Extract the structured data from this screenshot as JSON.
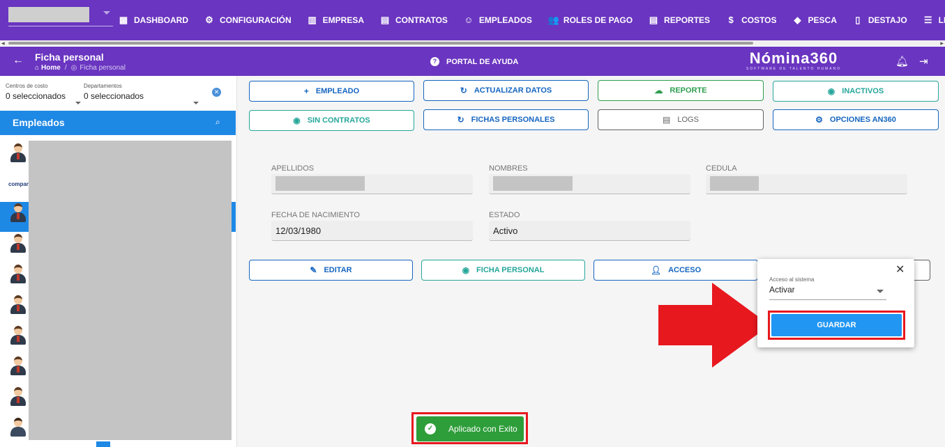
{
  "nav": {
    "items": [
      {
        "label": "DASHBOARD",
        "icon": "dashboard-icon",
        "glyph": "▦"
      },
      {
        "label": "CONFIGURACIÓN",
        "icon": "gear-icon",
        "glyph": "⚙"
      },
      {
        "label": "EMPRESA",
        "icon": "building-icon",
        "glyph": "▥"
      },
      {
        "label": "CONTRATOS",
        "icon": "clipboard-icon",
        "glyph": "▤"
      },
      {
        "label": "EMPLEADOS",
        "icon": "users-circle-icon",
        "glyph": "☺"
      },
      {
        "label": "ROLES DE PAGO",
        "icon": "group-icon",
        "glyph": "👥"
      },
      {
        "label": "REPORTES",
        "icon": "report-icon",
        "glyph": "▤"
      },
      {
        "label": "COSTOS",
        "icon": "invoice-icon",
        "glyph": "$"
      },
      {
        "label": "PESCA",
        "icon": "fish-icon",
        "glyph": "◆"
      },
      {
        "label": "DESTAJO",
        "icon": "document-icon",
        "glyph": "▯"
      },
      {
        "label": "LIQUIDACION",
        "icon": "list-icon",
        "glyph": "☰"
      }
    ]
  },
  "header": {
    "title": "Ficha personal",
    "breadcrumb_home": "Home",
    "breadcrumb_current": "Ficha personal",
    "help": "PORTAL DE AYUDA",
    "logo": "Nómina360",
    "logo_tagline": "SOFTWARE DE TALENTO HUMANO"
  },
  "filters": {
    "cost_centers_label": "Centros de costo",
    "cost_centers_value": "0 seleccionados",
    "departments_label": "Departamentos",
    "departments_value": "0 seleccionados"
  },
  "employees": {
    "title": "Empleados",
    "logo_text": "company"
  },
  "actions": {
    "empleado": "EMPLEADO",
    "actualizar": "ACTUALIZAR DATOS",
    "reporte": "REPORTE",
    "inactivos": "INACTIVOS",
    "sin_contratos": "SIN CONTRATOS",
    "fichas": "FICHAS PERSONALES",
    "logs": "LOGS",
    "opciones": "OPCIONES AN360"
  },
  "form": {
    "apellidos_label": "APELLIDOS",
    "nombres_label": "NOMBRES",
    "cedula_label": "CEDULA",
    "fecha_label": "FECHA DE NACIMIENTO",
    "fecha_value": "12/03/1980",
    "estado_label": "ESTADO",
    "estado_value": "Activo"
  },
  "detail_actions": {
    "editar": "EDITAR",
    "ficha": "FICHA PERSONAL",
    "acceso": "ACCESO"
  },
  "popup": {
    "label": "Acceso al sistema",
    "value": "Activar",
    "save": "GUARDAR"
  },
  "toast": {
    "message": "Aplicado con Exito"
  },
  "colors": {
    "nav": "#6a35c0",
    "primary": "#1e88e5",
    "success": "#2e9e3a",
    "highlight": "#e8181f"
  }
}
